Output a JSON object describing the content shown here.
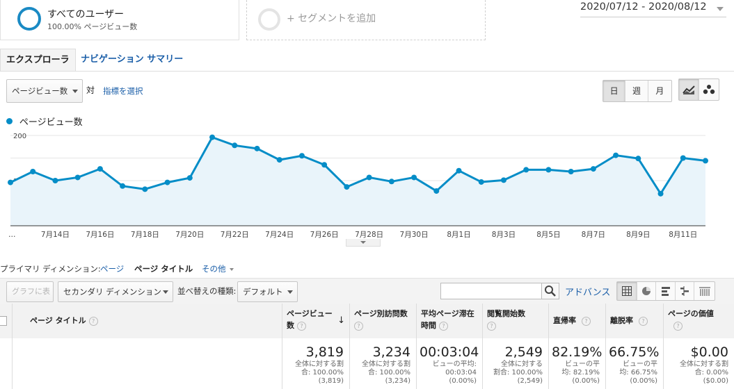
{
  "segments": {
    "primary_name": "すべてのユーザー",
    "primary_sub": "100.00% ページビュー数",
    "add_label": "+ セグメントを追加",
    "ring_color": "#1a8ac4"
  },
  "date_range": "2020/07/12 - 2020/08/12",
  "tabs": {
    "explorer": "エクスプローラ",
    "nav_summary": "ナビゲーション サマリー"
  },
  "metric_select": {
    "value": "ページビュー数",
    "vs": "対",
    "choose": "指標を選択"
  },
  "interval_buttons": [
    "日",
    "週",
    "月"
  ],
  "legend": {
    "label": "ページビュー数",
    "color": "#058dc7"
  },
  "chart_data": {
    "type": "area",
    "series": [
      {
        "name": "ページビュー数",
        "values": [
          96,
          120,
          100,
          107,
          126,
          88,
          81,
          96,
          106,
          196,
          178,
          171,
          146,
          155,
          135,
          86,
          107,
          98,
          107,
          77,
          122,
          97,
          101,
          124,
          124,
          120,
          126,
          156,
          149,
          71,
          150,
          144
        ]
      }
    ],
    "x_labels": [
      "…",
      "7月14日",
      "7月16日",
      "7月18日",
      "7月20日",
      "7月22日",
      "7月24日",
      "7月26日",
      "7月28日",
      "7月30日",
      "8月1日",
      "8月3日",
      "8月5日",
      "8月7日",
      "8月9日",
      "8月11日"
    ],
    "y_ticks": [
      "100",
      "200"
    ],
    "ylim": [
      0,
      200
    ],
    "grid": true,
    "color": "#058dc7"
  },
  "dimension": {
    "label": "プライマリ ディメンション:",
    "page": "ページ",
    "page_title": "ページ タイトル",
    "other": "その他"
  },
  "toolbar": {
    "graph_btn": "グラフに表示",
    "secondary": "セカンダリ ディメンション",
    "sort_label": "並べ替えの種類:",
    "sort_value": "デフォルト",
    "search_placeholder": "",
    "advanced": "アドバンス"
  },
  "table": {
    "headers": {
      "page_title": "ページ タイトル",
      "pageviews_1": "ページビュー",
      "pageviews_2": "数",
      "unique_1": "ページ別訪問数",
      "avg_1": "平均ページ滞在",
      "avg_2": "時間",
      "entrances": "閲覧開始数",
      "bounce": "直帰率",
      "exit": "離脱率",
      "value": "ページの価値"
    },
    "totals": [
      {
        "big": "3,819",
        "l1": "全体に対する割",
        "l2": "合: 100.00%",
        "l3": "(3,819)"
      },
      {
        "big": "3,234",
        "l1": "全体に対する割",
        "l2": "合: 100.00%",
        "l3": "(3,234)"
      },
      {
        "big": "00:03:04",
        "l1": "ビューの平均:",
        "l2": "00:03:04",
        "l3": "(0.00%)"
      },
      {
        "big": "2,549",
        "l1": "全体に対する",
        "l2": "割合: 100.00%",
        "l3": "(2,549)"
      },
      {
        "big": "82.19%",
        "l1": "ビューの平",
        "l2": "均: 82.19%",
        "l3": "(0.00%)"
      },
      {
        "big": "66.75%",
        "l1": "ビューの平",
        "l2": "均: 66.75%",
        "l3": "(0.00%)"
      },
      {
        "big": "$0.00",
        "l1": "全体に対する割",
        "l2": "合: 0.00%",
        "l3": "($0.00)"
      }
    ]
  }
}
